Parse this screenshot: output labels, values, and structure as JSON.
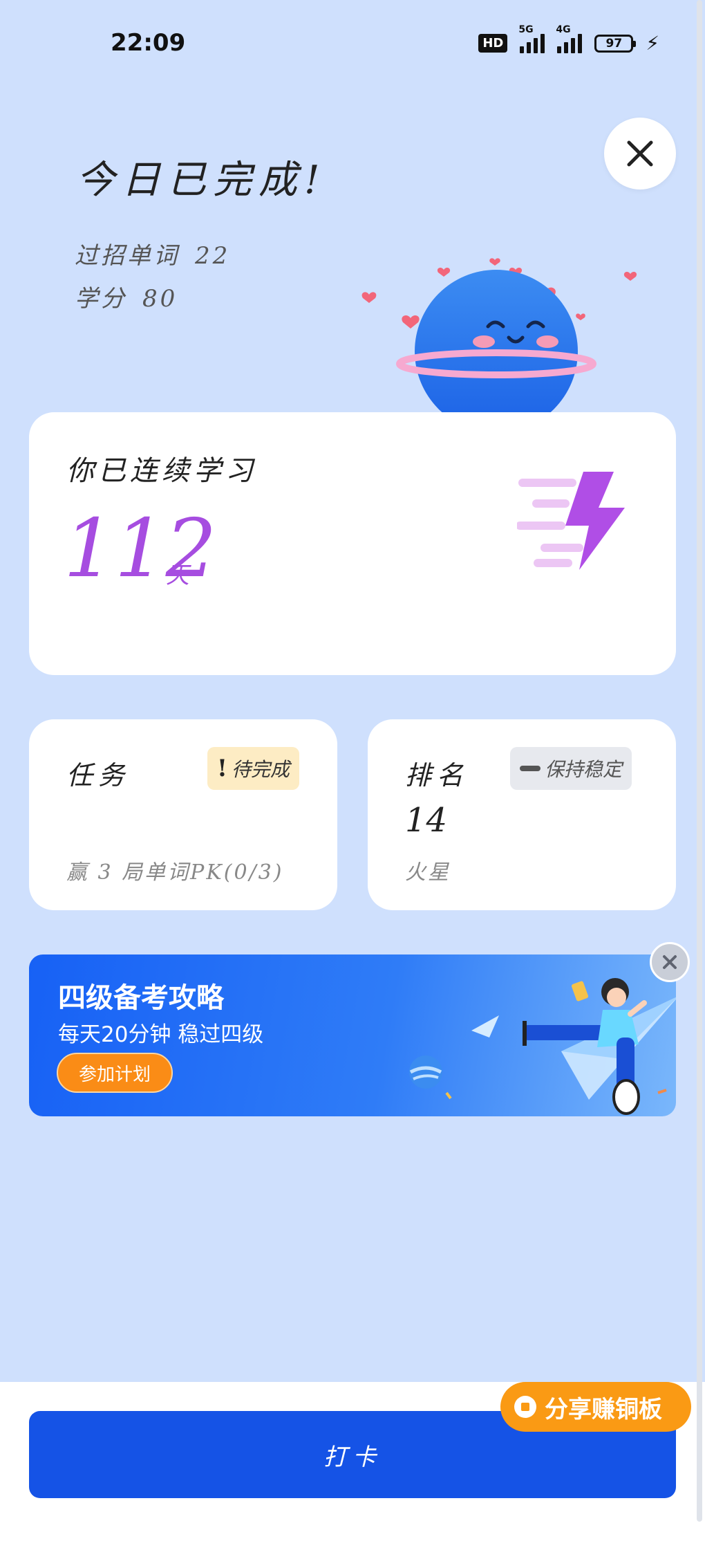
{
  "status_bar": {
    "time": "22:09",
    "hd": "HD",
    "signal1": "5G",
    "signal2": "4G",
    "battery": "97"
  },
  "header": {
    "title": "今日已完成!",
    "words_label": "过招单词",
    "words_value": "22",
    "credits_label": "学分",
    "credits_value": "80"
  },
  "streak": {
    "label": "你已连续学习",
    "days": "112",
    "unit": "天"
  },
  "task_card": {
    "title": "任务",
    "badge": "待完成",
    "badge_mark": "!",
    "detail": "赢 3 局单词PK(0/3)"
  },
  "rank_card": {
    "title": "排名",
    "badge": "保持稳定",
    "rank": "14",
    "league": "火星"
  },
  "banner": {
    "title": "四级备考攻略",
    "subtitle": "每天20分钟 稳过四级",
    "button": "参加计划"
  },
  "actions": {
    "checkin": "打卡",
    "share": "分享赚铜板"
  },
  "colors": {
    "background": "#cfe0fd",
    "primary": "#1553e6",
    "streak": "#a64de0",
    "share": "#fa9a14",
    "banner_button": "#fa8c16"
  },
  "icons": [
    "close-icon",
    "lightning-icon",
    "alert-icon",
    "dash-icon",
    "coin-icon",
    "battery-icon",
    "charging-icon",
    "signal-icon"
  ]
}
